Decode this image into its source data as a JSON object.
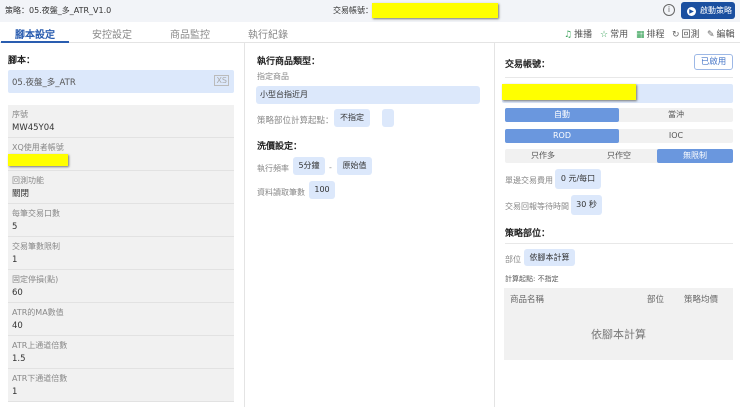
{
  "header": {
    "strategy_label": "策略：",
    "strategy_name": "05.夜盤_多_ATR_V1.0",
    "account_label": "交易帳號：",
    "start_button": "啟動策略",
    "accent": "#1a4fa0"
  },
  "tabs": [
    {
      "label": "腳本設定",
      "active": true
    },
    {
      "label": "安控設定"
    },
    {
      "label": "商品監控"
    },
    {
      "label": "執行紀錄"
    }
  ],
  "actions": [
    {
      "icon": "bell-icon",
      "label": "推播"
    },
    {
      "icon": "star-icon",
      "label": "常用"
    },
    {
      "icon": "calendar-icon",
      "label": "排程"
    },
    {
      "icon": "backtest-icon",
      "label": "回測"
    },
    {
      "icon": "pencil-icon",
      "label": "編輯"
    }
  ],
  "script": {
    "title": "腳本：",
    "name": "05.夜盤_多_ATR",
    "badge": "XS",
    "fields": [
      {
        "label": "序號",
        "value": "MW45Y04"
      },
      {
        "label": "XQ使用者帳號",
        "value": ""
      },
      {
        "label": "回測功能",
        "value": "關閉"
      },
      {
        "label": "每筆交易口數",
        "value": "5"
      },
      {
        "label": "交易筆數限制",
        "value": "1"
      },
      {
        "label": "固定停損(點)",
        "value": "60"
      },
      {
        "label": "ATR的MA數值",
        "value": "40"
      },
      {
        "label": "ATR上通道倍數",
        "value": "1.5"
      },
      {
        "label": "ATR下通道倍數",
        "value": "1"
      }
    ]
  },
  "product": {
    "title": "執行商品類型：",
    "sub": "指定商品",
    "value": "小型台指近月",
    "pos_label": "策略部位計算起點：",
    "pos_value": "不指定",
    "price_title": "洗價設定：",
    "freq_label": "執行頻率",
    "freq_value": "5分鐘",
    "dash": "-",
    "freq_mode": "原始值",
    "read_label": "資料讀取筆數",
    "read_value": "100"
  },
  "account": {
    "title": "交易帳號：",
    "status": "已啟用",
    "seg1": [
      "自動",
      "當沖"
    ],
    "seg2": [
      "ROD",
      "IOC"
    ],
    "seg3": [
      "只作多",
      "只作空",
      "無限制"
    ],
    "fee_label": "單邊交易費用",
    "fee_value": "0 元/每口",
    "wait_label": "交易回報等待時間",
    "wait_value": "30 秒",
    "pos_title": "策略部位：",
    "pos_label": "部位",
    "pos_value": "依腳本計算",
    "calc_label": "計算起點: 不指定",
    "table_headers": [
      "商品名稱",
      "部位",
      "策略均價"
    ],
    "table_empty": "依腳本計算"
  }
}
